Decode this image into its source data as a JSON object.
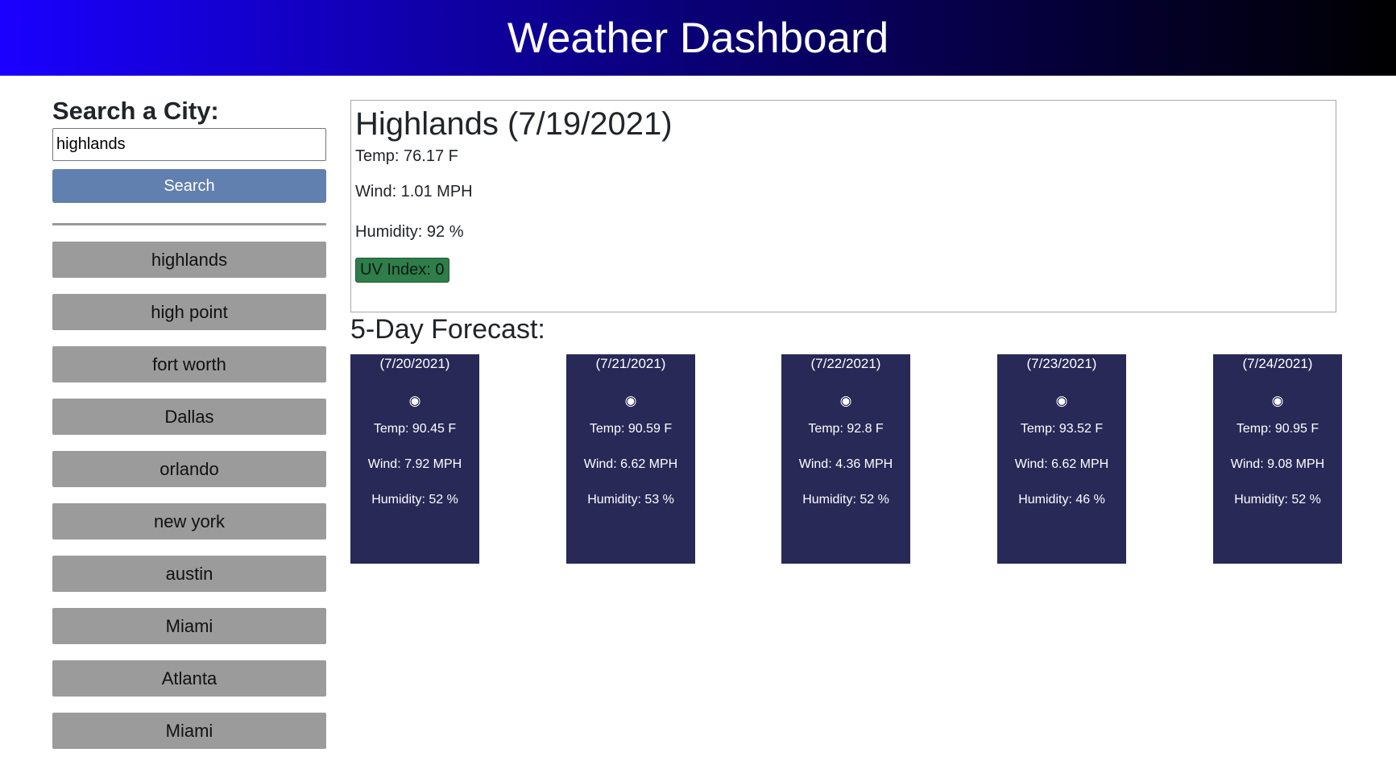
{
  "header": {
    "title": "Weather Dashboard"
  },
  "search": {
    "heading": "Search a City:",
    "input_value": "highlands",
    "button_label": "Search"
  },
  "history": [
    "highlands",
    "high point",
    "fort worth",
    "Dallas",
    "orlando",
    "new york",
    "austin",
    "Miami",
    "Atlanta",
    "Miami"
  ],
  "current": {
    "title": "Highlands (7/19/2021)",
    "temp": "Temp: 76.17 F",
    "wind": "Wind: 1.01 MPH",
    "humidity": "Humidity: 92 %",
    "uv": "UV Index: 0",
    "uv_color": "#2e7d4a"
  },
  "forecast": {
    "title": "5-Day Forecast:",
    "card_color": "#282957",
    "days": [
      {
        "date": "(7/20/2021)",
        "icon": "sun-icon",
        "icon_glyph": "◉",
        "temp": "Temp: 90.45 F",
        "wind": "Wind: 7.92 MPH",
        "humidity": "Humidity: 52 %"
      },
      {
        "date": "(7/21/2021)",
        "icon": "sun-icon",
        "icon_glyph": "◉",
        "temp": "Temp: 90.59 F",
        "wind": "Wind: 6.62 MPH",
        "humidity": "Humidity: 53 %"
      },
      {
        "date": "(7/22/2021)",
        "icon": "sun-icon",
        "icon_glyph": "◉",
        "temp": "Temp: 92.8 F",
        "wind": "Wind: 4.36 MPH",
        "humidity": "Humidity: 52 %"
      },
      {
        "date": "(7/23/2021)",
        "icon": "sun-icon",
        "icon_glyph": "◉",
        "temp": "Temp: 93.52 F",
        "wind": "Wind: 6.62 MPH",
        "humidity": "Humidity: 46 %"
      },
      {
        "date": "(7/24/2021)",
        "icon": "sun-icon",
        "icon_glyph": "◉",
        "temp": "Temp: 90.95 F",
        "wind": "Wind: 9.08 MPH",
        "humidity": "Humidity: 52 %"
      }
    ]
  }
}
